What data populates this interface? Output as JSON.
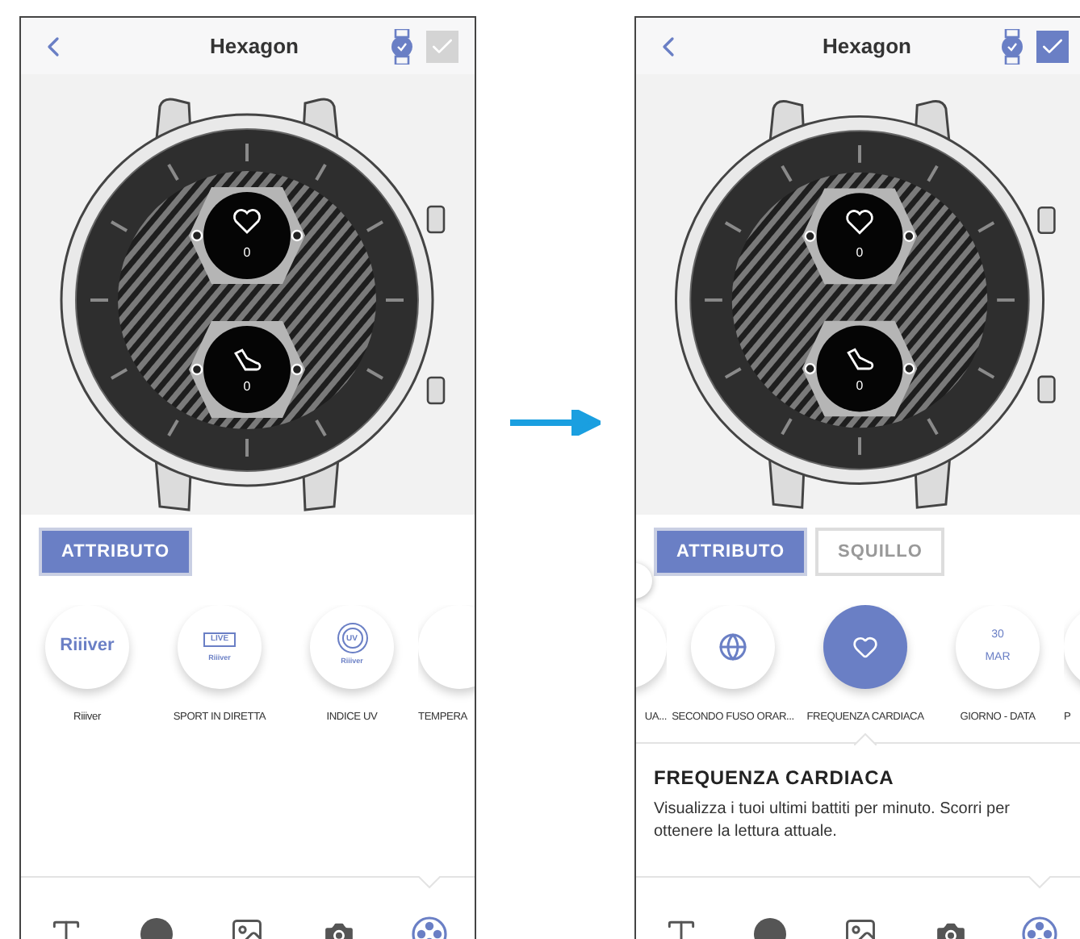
{
  "screens": [
    {
      "title": "Hexagon",
      "confirmed": false,
      "complications": [
        {
          "kind": "heart",
          "value": "0"
        },
        {
          "kind": "steps",
          "value": "0"
        }
      ],
      "tabs": [
        {
          "label": "ATTRIBUTO",
          "selected": true
        }
      ],
      "items": [
        {
          "kind": "logo",
          "icon_texts": [
            "Riiiver"
          ],
          "label": "Riiiver",
          "selected": false
        },
        {
          "kind": "live",
          "icon_texts": [
            "LIVE",
            "Riiiver"
          ],
          "label": "SPORT IN DIRETTA",
          "selected": false
        },
        {
          "kind": "uv",
          "icon_texts": [
            "UV",
            "Riiiver"
          ],
          "label": "INDICE UV",
          "selected": false
        },
        {
          "kind": "blank",
          "label": "TEMPERA",
          "selected": false
        }
      ],
      "toolbar": [
        {
          "kind": "text",
          "selected": false
        },
        {
          "kind": "dial",
          "selected": false
        },
        {
          "kind": "image",
          "selected": false
        },
        {
          "kind": "camera",
          "selected": false
        },
        {
          "kind": "attribute",
          "selected": true
        }
      ]
    },
    {
      "title": "Hexagon",
      "confirmed": true,
      "scroll_handle": true,
      "complications": [
        {
          "kind": "heart",
          "value": "0"
        },
        {
          "kind": "steps",
          "value": "0"
        }
      ],
      "tabs": [
        {
          "label": "ATTRIBUTO",
          "selected": true
        },
        {
          "label": "SQUILLO",
          "selected": false
        }
      ],
      "items": [
        {
          "kind": "blank",
          "label": "UA...",
          "selected": false
        },
        {
          "kind": "globe",
          "label": "SECONDO FUSO ORAR...",
          "selected": false
        },
        {
          "kind": "heart",
          "label": "FREQUENZA CARDIACA",
          "selected": true
        },
        {
          "kind": "date",
          "icon_texts": [
            "30",
            "MAR"
          ],
          "label": "GIORNO - DATA",
          "selected": false
        },
        {
          "kind": "blank",
          "label": "P",
          "selected": false
        }
      ],
      "detail": {
        "title": "FREQUENZA CARDIACA",
        "text": "Visualizza i tuoi ultimi battiti per minuto. Scorri per ottenere la lettura attuale."
      },
      "toolbar": [
        {
          "kind": "text",
          "selected": false
        },
        {
          "kind": "dial",
          "selected": false
        },
        {
          "kind": "image",
          "selected": false
        },
        {
          "kind": "camera",
          "selected": false
        },
        {
          "kind": "attribute",
          "selected": true
        }
      ]
    }
  ]
}
